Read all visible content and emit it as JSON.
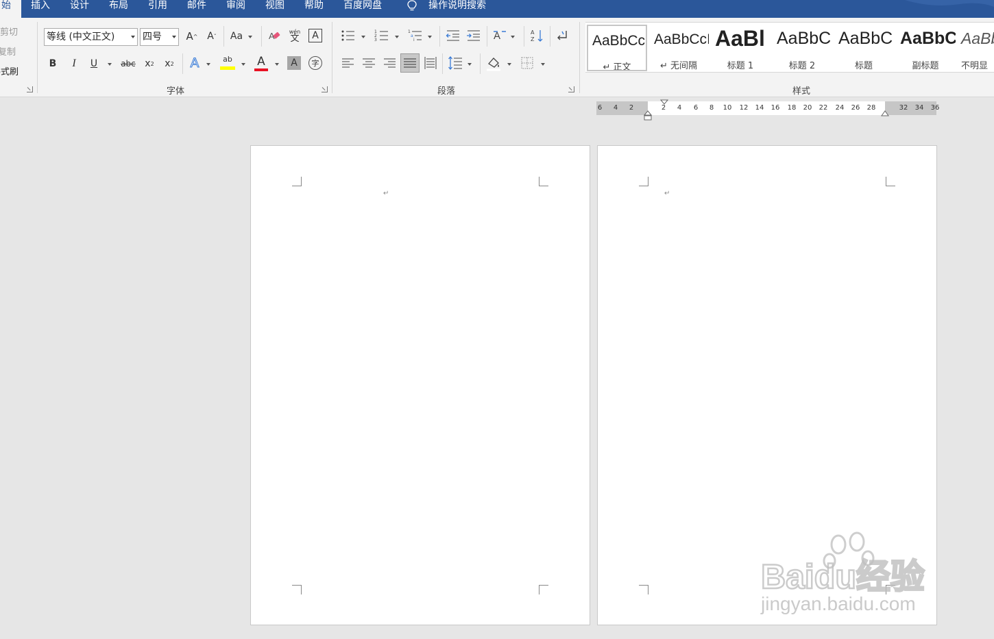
{
  "menu": {
    "tabs": [
      {
        "label": "始",
        "active": true
      },
      {
        "label": "插入"
      },
      {
        "label": "设计"
      },
      {
        "label": "布局"
      },
      {
        "label": "引用"
      },
      {
        "label": "邮件"
      },
      {
        "label": "审阅"
      },
      {
        "label": "视图"
      },
      {
        "label": "帮助"
      },
      {
        "label": "百度网盘"
      }
    ],
    "search_label": "操作说明搜索",
    "bar_color": "#2b579a"
  },
  "clipboard": {
    "cut_label": "剪切",
    "copy_label": "复制",
    "format_painter_label": "格式刷"
  },
  "font_group": {
    "label": "字体",
    "font_name": "等线 (中文正文)",
    "font_size": "四号",
    "buttons": {
      "grow": "A",
      "shrink": "A",
      "change_case": "Aa",
      "phonetic": "wén",
      "phonetic_char": "文",
      "char_border": "A",
      "bold": "B",
      "italic": "I",
      "underline": "U",
      "strikethrough": "abc",
      "subscript": "x",
      "superscript": "x",
      "text_effect": "A",
      "highlight": "ab",
      "font_color": "A",
      "char_shading": "A",
      "enclose": "字"
    },
    "highlight_color": "#ffff00",
    "font_color_value": "#e81123"
  },
  "paragraph_group": {
    "label": "段落"
  },
  "styles_group": {
    "label": "样式",
    "items": [
      {
        "sample": "AaBbCcI",
        "name": "↵ 正文",
        "selected": true
      },
      {
        "sample": "AaBbCcI",
        "name": "↵ 无间隔"
      },
      {
        "sample": "AaBl",
        "name": "标题 1"
      },
      {
        "sample": "AaBbC",
        "name": "标题 2"
      },
      {
        "sample": "AaBbC",
        "name": "标题"
      },
      {
        "sample": "AaBbC",
        "name": "副标题"
      },
      {
        "sample": "AaBbC",
        "name": "不明显"
      }
    ]
  },
  "ruler": {
    "ticks": [
      "6",
      "4",
      "2",
      "2",
      "4",
      "6",
      "8",
      "10",
      "12",
      "14",
      "16",
      "18",
      "20",
      "22",
      "24",
      "26",
      "28",
      "32",
      "34",
      "36"
    ]
  },
  "document": {
    "paragraph_mark": "↵"
  },
  "watermark": {
    "brand": "Baidu经验",
    "url": "jingyan.baidu.com"
  }
}
